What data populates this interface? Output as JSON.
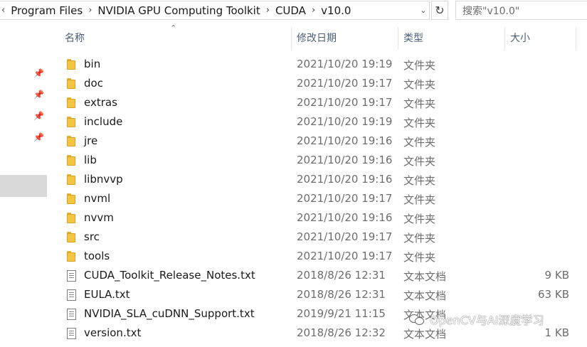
{
  "address_bar": {
    "breadcrumbs": [
      "Program Files",
      "NVIDIA GPU Computing Toolkit",
      "CUDA",
      "v10.0"
    ],
    "separator": "›",
    "overflow_glyph": "‹"
  },
  "search": {
    "placeholder": "搜索\"v10.0\""
  },
  "columns": {
    "name": "名称",
    "date": "修改日期",
    "type": "类型",
    "size": "大小"
  },
  "files": [
    {
      "name": "bin",
      "date": "2021/10/20 19:19",
      "type": "文件夹",
      "size": "",
      "kind": "folder"
    },
    {
      "name": "doc",
      "date": "2021/10/20 19:17",
      "type": "文件夹",
      "size": "",
      "kind": "folder"
    },
    {
      "name": "extras",
      "date": "2021/10/20 19:17",
      "type": "文件夹",
      "size": "",
      "kind": "folder"
    },
    {
      "name": "include",
      "date": "2021/10/20 19:19",
      "type": "文件夹",
      "size": "",
      "kind": "folder"
    },
    {
      "name": "jre",
      "date": "2021/10/20 19:16",
      "type": "文件夹",
      "size": "",
      "kind": "folder"
    },
    {
      "name": "lib",
      "date": "2021/10/20 19:16",
      "type": "文件夹",
      "size": "",
      "kind": "folder"
    },
    {
      "name": "libnvvp",
      "date": "2021/10/20 19:16",
      "type": "文件夹",
      "size": "",
      "kind": "folder"
    },
    {
      "name": "nvml",
      "date": "2021/10/20 19:17",
      "type": "文件夹",
      "size": "",
      "kind": "folder"
    },
    {
      "name": "nvvm",
      "date": "2021/10/20 19:16",
      "type": "文件夹",
      "size": "",
      "kind": "folder"
    },
    {
      "name": "src",
      "date": "2021/10/20 19:17",
      "type": "文件夹",
      "size": "",
      "kind": "folder"
    },
    {
      "name": "tools",
      "date": "2021/10/20 19:17",
      "type": "文件夹",
      "size": "",
      "kind": "folder"
    },
    {
      "name": "CUDA_Toolkit_Release_Notes.txt",
      "date": "2018/8/26 12:31",
      "type": "文本文档",
      "size": "9 KB",
      "kind": "file"
    },
    {
      "name": "EULA.txt",
      "date": "2018/8/26 12:31",
      "type": "文本文档",
      "size": "63 KB",
      "kind": "file"
    },
    {
      "name": "NVIDIA_SLA_cuDNN_Support.txt",
      "date": "2019/9/21 11:15",
      "type": "文本文档",
      "size": "",
      "kind": "file"
    },
    {
      "name": "version.txt",
      "date": "2018/8/26 12:32",
      "type": "文本文档",
      "size": "1 KB",
      "kind": "file"
    }
  ],
  "watermark": {
    "text": "OpenCV与AI深度学习"
  },
  "icons": {
    "folder": "folder-icon",
    "file": "text-file-icon",
    "pin": "pin-icon",
    "refresh": "refresh-icon",
    "dropdown": "chevron-down-icon"
  }
}
